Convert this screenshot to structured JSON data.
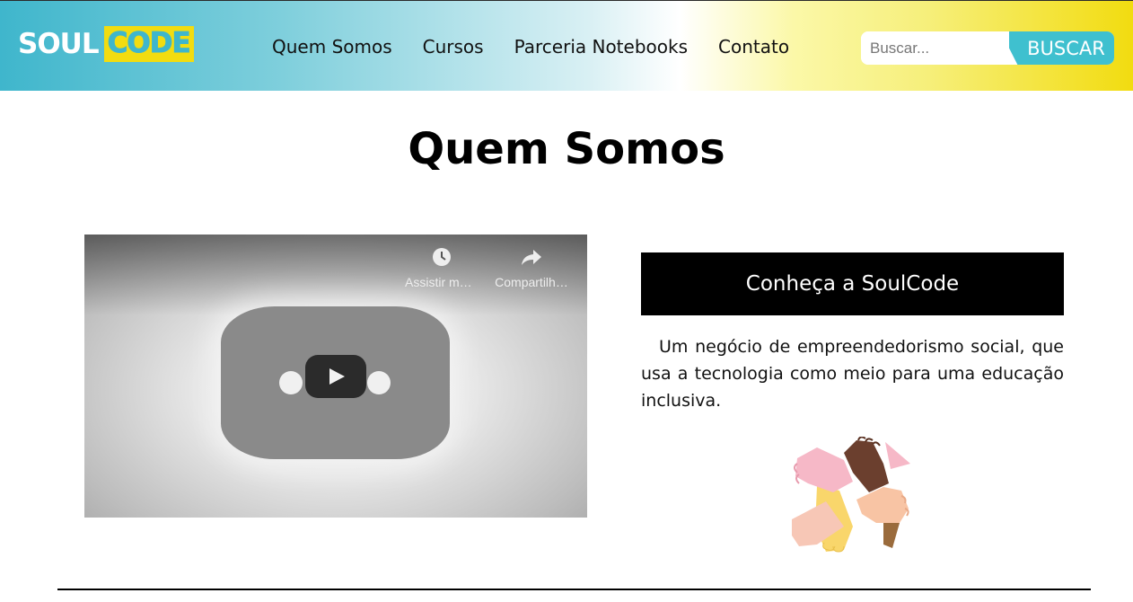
{
  "header": {
    "logo": {
      "part1": "SOUL",
      "part2": "CODE"
    },
    "nav": [
      {
        "label": "Quem Somos"
      },
      {
        "label": "Cursos"
      },
      {
        "label": "Parceria Notebooks"
      },
      {
        "label": "Contato"
      }
    ],
    "search": {
      "placeholder": "Buscar...",
      "button_label": "BUSCAR"
    }
  },
  "main": {
    "title": "Quem Somos",
    "video": {
      "watch_later_label": "Assistir ma…",
      "share_label": "Compartilh…",
      "icons": [
        "clock-icon",
        "share-icon",
        "play-icon"
      ]
    },
    "cta_label": "Conheça a SoulCode",
    "description": "Um negócio de empreendedorismo social, que usa a tecnologia como meio para uma educação inclusiva.",
    "illustration": "hands-together-icon"
  },
  "colors": {
    "accent_cyan": "#3fb6cc",
    "accent_yellow": "#f2dc10",
    "cta_background": "#000000"
  }
}
